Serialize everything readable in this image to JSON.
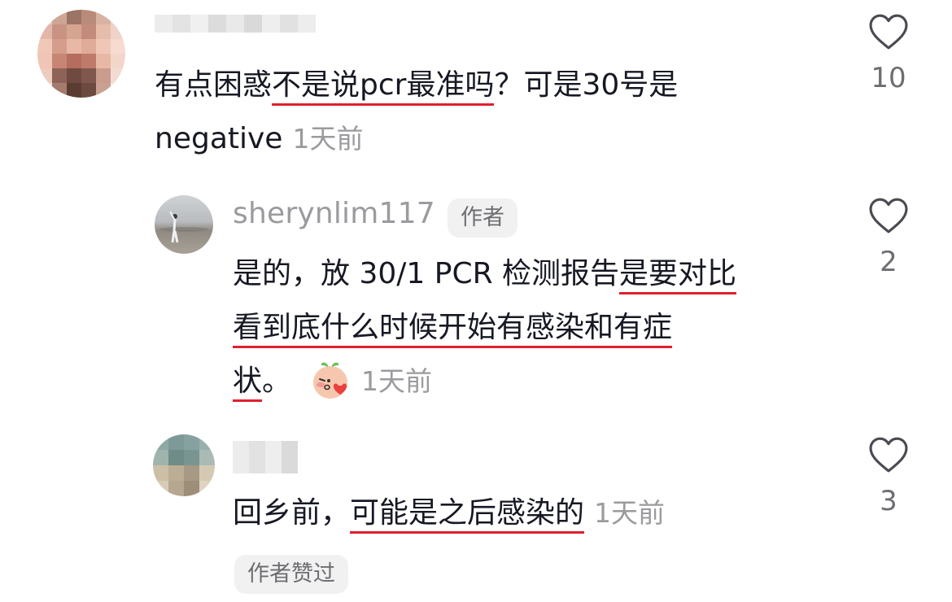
{
  "comments": [
    {
      "username": "",
      "segments": [
        "有点困惑",
        "不是说pcr最准吗",
        "？可是30号是",
        "negative"
      ],
      "time": "1天前",
      "likes": "10"
    },
    {
      "username": "sherynlim117",
      "badge": "作者",
      "segments": [
        "是的，放 30/1 PCR 检测报告",
        "是要对比",
        "看到底什么时候开始有感染和有症",
        "状",
        "。"
      ],
      "time": "1天前",
      "likes": "2"
    },
    {
      "username": "",
      "segments": [
        "回乡前，",
        "可能是之后感染的"
      ],
      "time": "1天前",
      "likes": "3",
      "liked_badge": "作者赞过"
    }
  ],
  "colors": {
    "accent_underline": "#e0202f",
    "secondary_text": "#9b9b9f"
  },
  "icons": {
    "like": "heart-outline-icon",
    "emoji": "blushing-peach-emoji-icon"
  }
}
